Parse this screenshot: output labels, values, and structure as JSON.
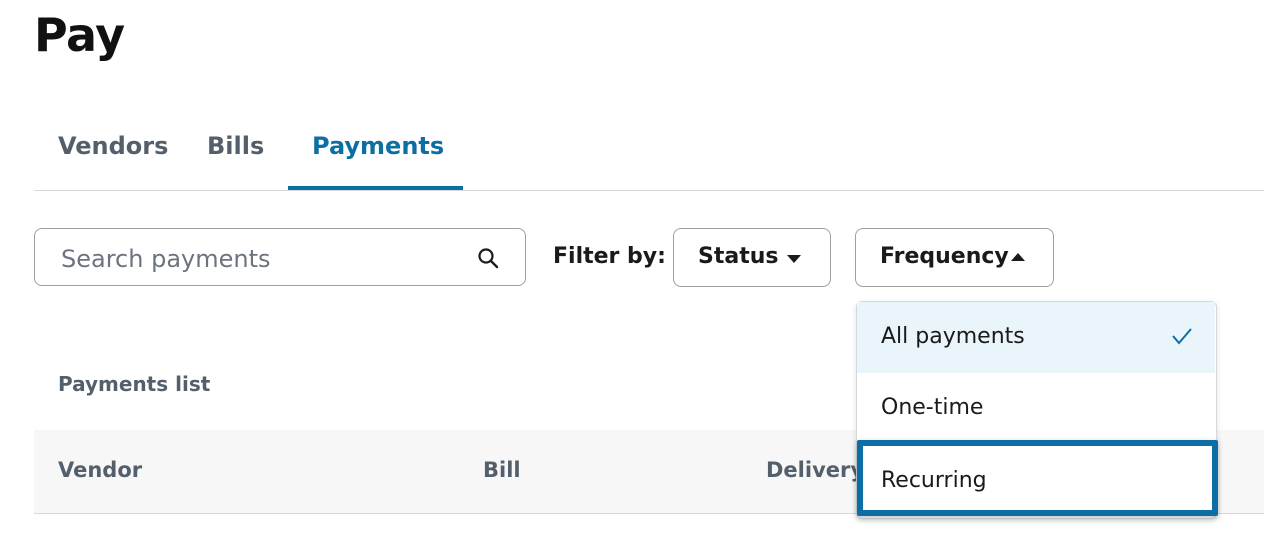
{
  "page": {
    "title": "Pay"
  },
  "tabs": [
    {
      "label": "Vendors",
      "active": false
    },
    {
      "label": "Bills",
      "active": false
    },
    {
      "label": "Payments",
      "active": true
    }
  ],
  "search": {
    "placeholder": "Search payments",
    "value": "",
    "icon": "search-icon"
  },
  "filters": {
    "label": "Filter by:",
    "status": {
      "label": "Status",
      "icon": "caret-down-icon"
    },
    "frequency": {
      "label": "Frequency",
      "icon": "caret-up-icon",
      "expanded": true
    }
  },
  "frequency_menu": {
    "options": [
      {
        "label": "All payments",
        "selected": true
      },
      {
        "label": "One-time",
        "selected": false
      },
      {
        "label": "Recurring",
        "selected": false,
        "focused": true
      }
    ],
    "check_icon": "check-icon"
  },
  "payments_list": {
    "title": "Payments list",
    "columns": [
      "Vendor",
      "Bill",
      "Delivery"
    ]
  },
  "colors": {
    "accent": "#0d6ea3",
    "selected_bg": "#e9f4fb",
    "muted_text": "#545f6c",
    "border": "#9aa0a6"
  }
}
